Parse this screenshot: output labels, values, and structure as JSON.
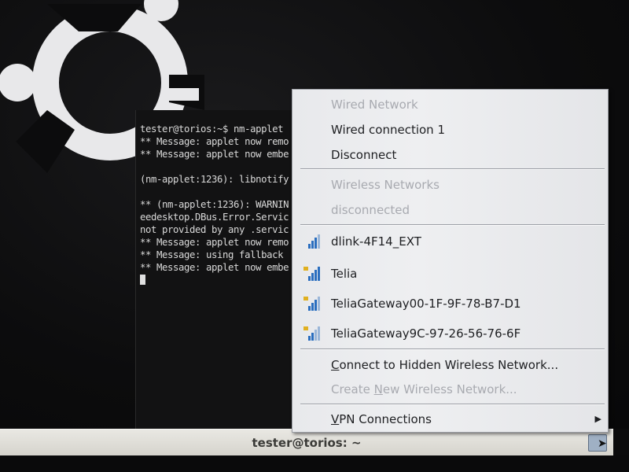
{
  "terminal": {
    "lines": [
      "tester@torios:~$ nm-applet",
      "** Message: applet now remo",
      "** Message: applet now embe",
      "",
      "(nm-applet:1236): libnotify",
      "",
      "** (nm-applet:1236): WARNIN",
      "eedesktop.DBus.Error.Servic",
      "not provided by any .servic",
      "** Message: applet now remo",
      "** Message: using fallback",
      "** Message: applet now embe"
    ]
  },
  "taskbar": {
    "title": "tester@torios: ~"
  },
  "menu": {
    "wired_header": "Wired Network",
    "wired_connection": "Wired connection 1",
    "disconnect": "Disconnect",
    "wireless_header": "Wireless Networks",
    "wireless_status": "disconnected",
    "networks": [
      {
        "ssid": "dlink-4F14_EXT",
        "icon": "wifi-signal-icon"
      },
      {
        "ssid": "Telia",
        "icon": "wifi-signal-icon"
      },
      {
        "ssid": "TeliaGateway00-1F-9F-78-B7-D1",
        "icon": "wifi-signal-icon"
      },
      {
        "ssid": "TeliaGateway9C-97-26-56-76-6F",
        "icon": "wifi-signal-icon"
      }
    ],
    "hidden_network_pre": "",
    "hidden_network_ul": "C",
    "hidden_network_post": "onnect to Hidden Wireless Network...",
    "create_network_pre": "Create ",
    "create_network_ul": "N",
    "create_network_post": "ew Wireless Network...",
    "vpn_ul": "V",
    "vpn_post": "PN Connections"
  },
  "colors": {
    "menu_bg": "#eeeff1",
    "menu_text": "#1e1f22",
    "menu_disabled": "#a8aab0",
    "taskbar_bg": "#dedcd5",
    "desktop_bg": "#0c0c0d",
    "signal_bar": "#2a6ebf",
    "lock_color": "#e0b020"
  }
}
